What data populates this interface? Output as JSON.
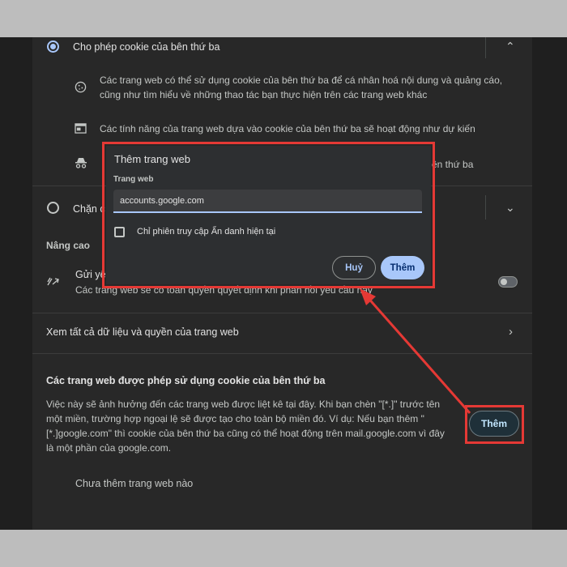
{
  "settings": {
    "allow_third_party_label": "Cho phép cookie của bên thứ ba",
    "allow_desc_1": "Các trang web có thể sử dụng cookie của bên thứ ba để cá nhân hoá nội dung và quảng cáo, cũng như tìm hiểu về những thao tác bạn thực hiện trên các trang web khác",
    "allow_desc_2": "Các tính năng của trang web dựa vào cookie của bên thứ ba sẽ hoạt động như dự kiến",
    "allow_desc_3_partial": "ên thứ ba",
    "block_label_partial": "Chặn c",
    "advanced_heading": "Nâng cao",
    "send_request_partial": "Gửi yê",
    "send_request_desc": "Các trang web sẽ có toàn quyền quyết định khi phản hồi yêu cầu này",
    "see_all_label": "Xem tất cả dữ liệu và quyền của trang web",
    "allowed_sites_heading": "Các trang web được phép sử dụng cookie của bên thứ ba",
    "allowed_sites_desc": "Việc này sẽ ảnh hưởng đến các trang web được liệt kê tại đây. Khi bạn chèn \"[*.]\" trước tên một miền, trường hợp ngoại lệ sẽ được tạo cho toàn bộ miền đó. Ví dụ: Nếu bạn thêm \"[*.]google.com\" thì cookie của bên thứ ba cũng có thể hoạt động trên mail.google.com vì đây là một phần của google.com.",
    "add_button": "Thêm",
    "no_sites_text": "Chưa thêm trang web nào"
  },
  "dialog": {
    "title": "Thêm trang web",
    "field_label": "Trang web",
    "input_value": "accounts.google.com",
    "checkbox_label": "Chỉ phiên truy cập Ẩn danh hiện tại",
    "cancel_button": "Huỷ",
    "confirm_button": "Thêm"
  },
  "colors": {
    "highlight": "#e53935",
    "accent": "#a8c7fa",
    "panel": "#282828"
  }
}
